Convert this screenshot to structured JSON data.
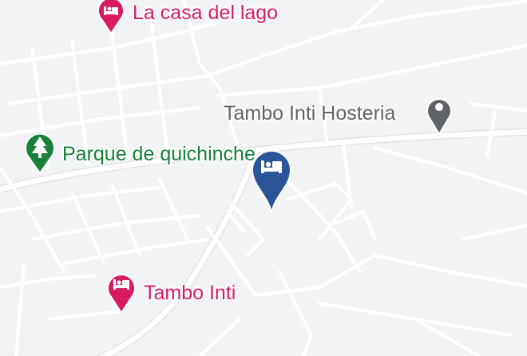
{
  "map": {
    "places": [
      {
        "id": "la-casa-del-lago",
        "name": "La casa del lago",
        "category": "hotel",
        "icon": "bed-icon",
        "color": "#d81b60"
      },
      {
        "id": "tambo-inti-hosteria",
        "name": "Tambo Inti Hosteria",
        "category": "place",
        "icon": "place-pin-icon",
        "color": "#5f6368"
      },
      {
        "id": "parque-de-quichinche",
        "name": "Parque de quichinche",
        "category": "park",
        "icon": "tree-icon",
        "color": "#188038"
      },
      {
        "id": "tambo-inti",
        "name": "Tambo Inti",
        "category": "hotel",
        "icon": "bed-icon",
        "color": "#d81b60"
      }
    ],
    "selected_marker": {
      "category": "hotel",
      "icon": "bed-icon",
      "color": "#2a5699"
    }
  }
}
